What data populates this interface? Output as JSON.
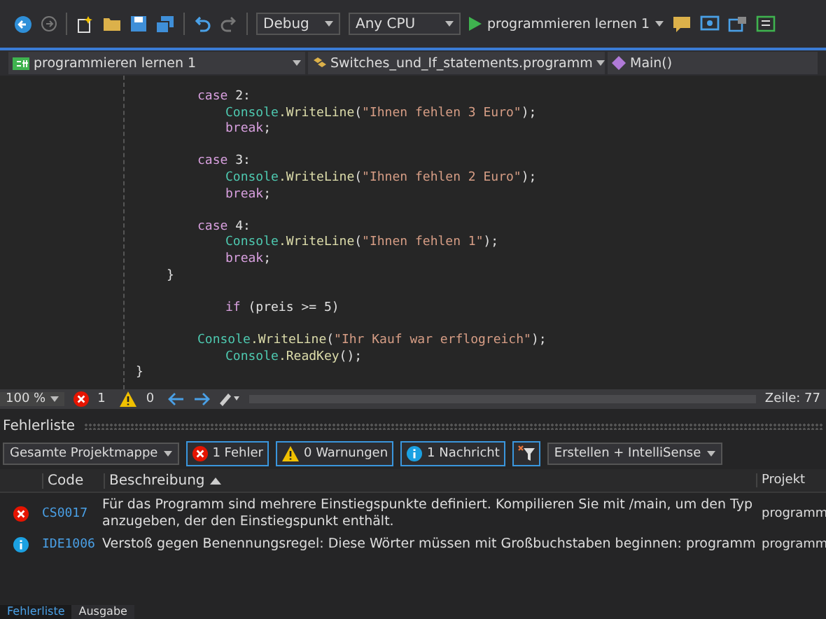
{
  "toolbar": {
    "configuration": "Debug",
    "platform": "Any CPU",
    "start_target": "programmieren lernen 1"
  },
  "nav_bar": {
    "project": "programmieren lernen 1",
    "class": "Switches_und_If_statements.programm",
    "member": "Main()"
  },
  "editor": {
    "lines": [
      {
        "kind": "case",
        "tokens": [
          {
            "t": "case",
            "kind": "kw"
          },
          {
            "t": " 2:",
            "kind": "plain"
          }
        ]
      },
      {
        "kind": "stmt",
        "tokens": [
          {
            "t": "Console",
            "kind": "cls"
          },
          {
            "t": ".WriteLine",
            "kind": "fn"
          },
          {
            "t": "(",
            "kind": "plain"
          },
          {
            "t": "\"Ihnen fehlen 3 Euro\"",
            "kind": "str"
          },
          {
            "t": ");",
            "kind": "plain"
          }
        ]
      },
      {
        "kind": "stmt",
        "tokens": [
          {
            "t": "break",
            "kind": "kw"
          },
          {
            "t": ";",
            "kind": "plain"
          }
        ]
      },
      {
        "kind": "blank"
      },
      {
        "kind": "case",
        "tokens": [
          {
            "t": "case",
            "kind": "kw"
          },
          {
            "t": " 3:",
            "kind": "plain"
          }
        ]
      },
      {
        "kind": "stmt",
        "tokens": [
          {
            "t": "Console",
            "kind": "cls"
          },
          {
            "t": ".WriteLine",
            "kind": "fn"
          },
          {
            "t": "(",
            "kind": "plain"
          },
          {
            "t": "\"Ihnen fehlen 2 Euro\"",
            "kind": "str"
          },
          {
            "t": ");",
            "kind": "plain"
          }
        ]
      },
      {
        "kind": "stmt",
        "tokens": [
          {
            "t": "break",
            "kind": "kw"
          },
          {
            "t": ";",
            "kind": "plain"
          }
        ]
      },
      {
        "kind": "blank"
      },
      {
        "kind": "case",
        "tokens": [
          {
            "t": "case",
            "kind": "kw"
          },
          {
            "t": " 4:",
            "kind": "plain"
          }
        ]
      },
      {
        "kind": "stmt",
        "tokens": [
          {
            "t": "Console",
            "kind": "cls"
          },
          {
            "t": ".WriteLine",
            "kind": "fn"
          },
          {
            "t": "(",
            "kind": "plain"
          },
          {
            "t": "\"Ihnen fehlen 1\"",
            "kind": "str"
          },
          {
            "t": ");",
            "kind": "plain"
          }
        ]
      },
      {
        "kind": "stmt",
        "tokens": [
          {
            "t": "break",
            "kind": "kw"
          },
          {
            "t": ";",
            "kind": "plain"
          }
        ]
      },
      {
        "kind": "close",
        "tokens": [
          {
            "t": "}",
            "kind": "plain"
          }
        ]
      },
      {
        "kind": "blank"
      },
      {
        "kind": "stmt",
        "tokens": [
          {
            "t": "if",
            "kind": "kw"
          },
          {
            "t": " (preis >= 5)",
            "kind": "plain"
          }
        ]
      },
      {
        "kind": "blank"
      },
      {
        "kind": "case",
        "tokens": [
          {
            "t": "Console",
            "kind": "cls"
          },
          {
            "t": ".WriteLine",
            "kind": "fn"
          },
          {
            "t": "(",
            "kind": "plain"
          },
          {
            "t": "\"Ihr Kauf war erflogreich\"",
            "kind": "str"
          },
          {
            "t": ");",
            "kind": "plain"
          }
        ]
      },
      {
        "kind": "stmt",
        "tokens": [
          {
            "t": "Console",
            "kind": "cls"
          },
          {
            "t": ".ReadKey",
            "kind": "fn"
          },
          {
            "t": "();",
            "kind": "plain"
          }
        ]
      },
      {
        "kind": "outer",
        "tokens": [
          {
            "t": "}",
            "kind": "plain"
          }
        ]
      }
    ]
  },
  "status_strip": {
    "zoom": "100 %",
    "errors": "1",
    "warnings": "0",
    "line": "Zeile: 77"
  },
  "error_list": {
    "title": "Fehlerliste",
    "scope": "Gesamte Projektmappe",
    "filters": [
      {
        "kind": "error",
        "label": "1 Fehler",
        "selected": true
      },
      {
        "kind": "warning",
        "label": "0 Warnungen",
        "selected": true
      },
      {
        "kind": "info",
        "label": "1 Nachricht",
        "selected": true
      }
    ],
    "source": "Erstellen + IntelliSense",
    "columns": [
      "Code",
      "Beschreibung",
      "Projekt"
    ],
    "rows": [
      {
        "kind": "error",
        "code": "CS0017",
        "description": "Für das Programm sind mehrere Einstiegspunkte definiert. Kompilieren Sie mit /main, um den Typ anzugeben, der den Einstiegspunkt enthält.",
        "project": "programm"
      },
      {
        "kind": "info",
        "code": "IDE1006",
        "description": "Verstoß gegen Benennungsregel: Diese Wörter müssen mit Großbuchstaben beginnen: programm",
        "project": "programm"
      }
    ]
  },
  "bottom_tabs": [
    {
      "label": "Fehlerliste",
      "selected": true
    },
    {
      "label": "Ausgabe",
      "selected": false
    }
  ]
}
